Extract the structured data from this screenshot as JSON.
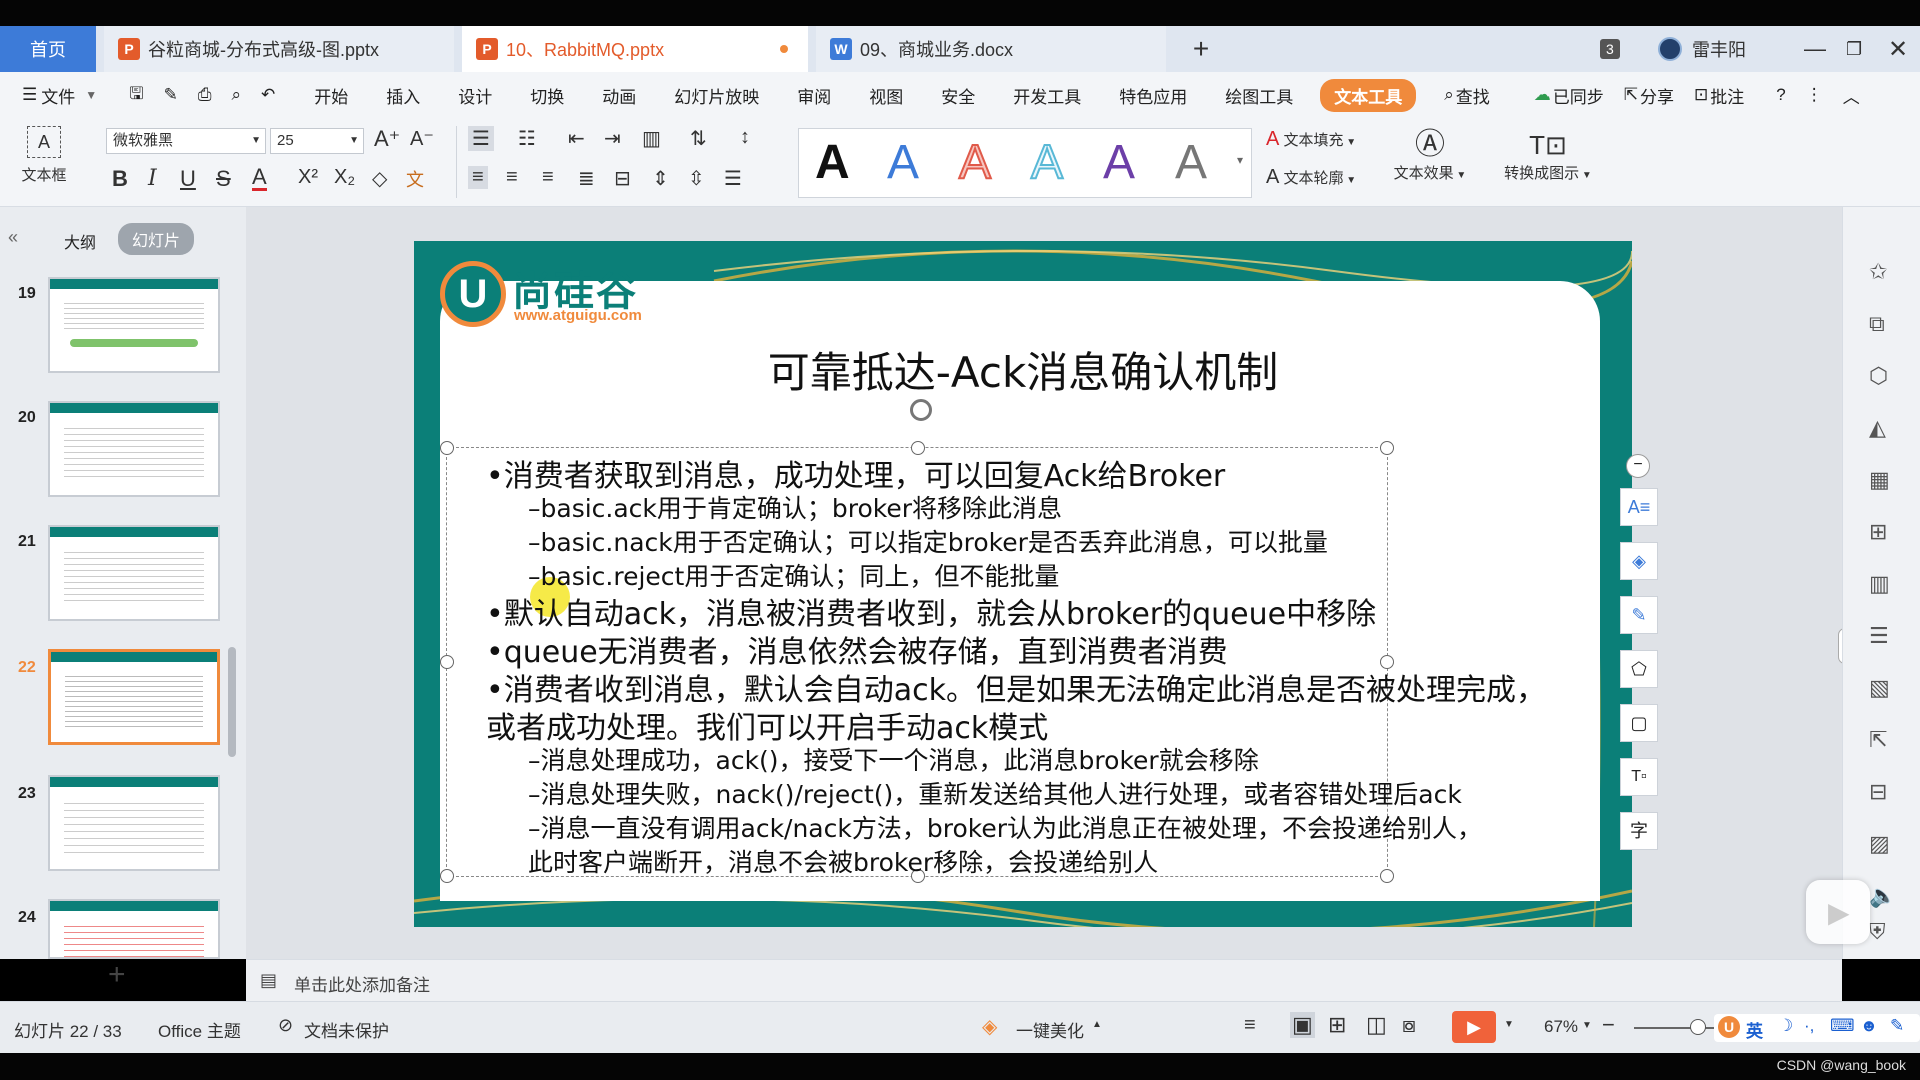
{
  "tabs": {
    "home": "首页",
    "file1": "谷粒商城-分布式高级-图.pptx",
    "file2": "10、RabbitMQ.pptx",
    "file3": "09、商城业务.docx",
    "badge": "3",
    "user": "雷丰阳"
  },
  "menu": {
    "file": "文件",
    "items": [
      "开始",
      "插入",
      "设计",
      "切换",
      "动画",
      "幻灯片放映",
      "审阅",
      "视图",
      "安全",
      "开发工具",
      "特色应用",
      "绘图工具"
    ],
    "active": "文本工具",
    "search": "查找",
    "sync": "已同步",
    "share": "分享",
    "comment": "批注"
  },
  "ribbon": {
    "textbox": "文本框",
    "font_name": "微软雅黑",
    "font_size": "25",
    "text_fill": "文本填充",
    "text_outline": "文本轮廓",
    "text_effect": "文本效果",
    "convert": "转换成图示"
  },
  "left_panel": {
    "tab_outline": "大纲",
    "tab_slides": "幻灯片",
    "slide_numbers": [
      "19",
      "20",
      "21",
      "22",
      "23",
      "24"
    ]
  },
  "slide": {
    "logo_text": "尚硅谷",
    "logo_url": "www.atguigu.com",
    "title": "可靠抵达-Ack消息确认机制",
    "lines": [
      "•消费者获取到消息，成功处理，可以回复Ack给Broker",
      "–basic.ack用于肯定确认；broker将移除此消息",
      "–basic.nack用于否定确认；可以指定broker是否丢弃此消息，可以批量",
      "–basic.reject用于否定确认；同上，但不能批量",
      "•默认自动ack，消息被消费者收到，就会从broker的queue中移除",
      "•queue无消费者，消息依然会被存储，直到消费者消费",
      "•消费者收到消息，默认会自动ack。但是如果无法确定此消息是否被处理完成，",
      "或者成功处理。我们可以开启手动ack模式",
      "–消息处理成功，ack()，接受下一个消息，此消息broker就会移除",
      "–消息处理失败，nack()/reject()，重新发送给其他人进行处理，或者容错处理后ack",
      "–消息一直没有调用ack/nack方法，broker认为此消息正在被处理，不会投递给别人，",
      "此时客户端断开，消息不会被broker移除，会投递给别人"
    ]
  },
  "notes": "单击此处添加备注",
  "status": {
    "slide_count": "幻灯片 22 / 33",
    "theme": "Office 主题",
    "protect": "文档未保护",
    "beautify": "一键美化",
    "zoom": "67%",
    "ime": "英",
    "watermark": "CSDN @wang_book"
  },
  "colors": {
    "accent": "#f08a3c",
    "home_tab": "#3d7bd8",
    "slide_teal": "#0b7f78"
  }
}
